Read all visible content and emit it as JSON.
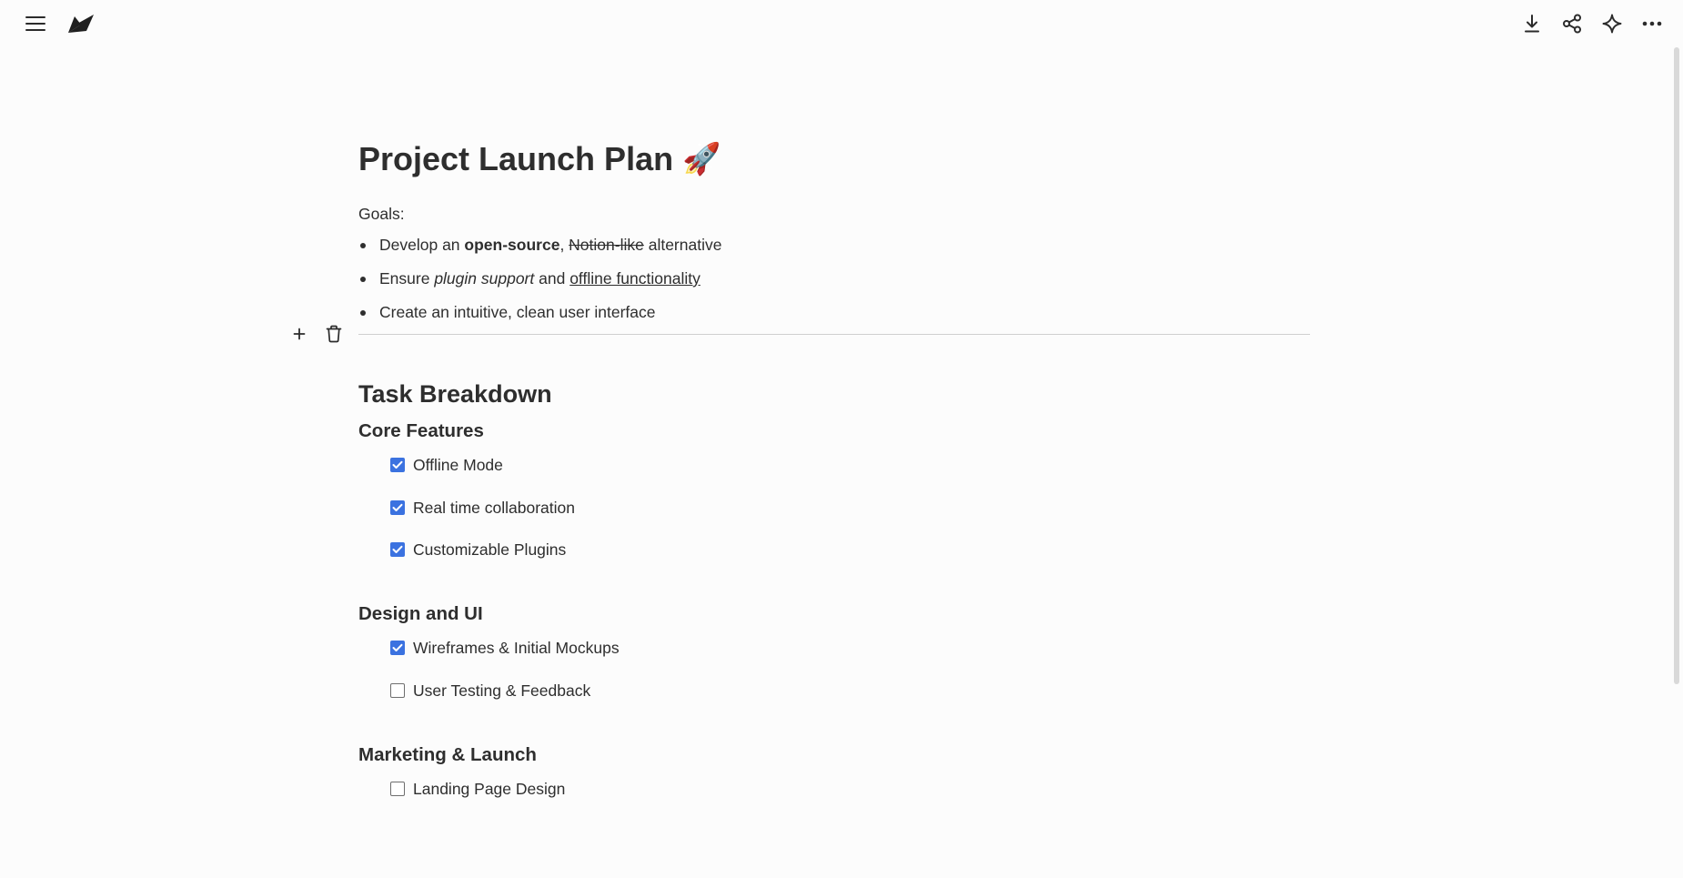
{
  "app": {
    "accent_color": "#3b72e0"
  },
  "toolbar": {
    "left": [
      {
        "icon": "menu-icon"
      },
      {
        "icon": "logo-icon"
      }
    ],
    "right": [
      {
        "icon": "download-icon"
      },
      {
        "icon": "share-icon"
      },
      {
        "icon": "sparkle-icon"
      },
      {
        "icon": "more-icon"
      }
    ]
  },
  "document": {
    "title": "Project Launch Plan",
    "title_emoji": "🚀",
    "goals_label": "Goals:",
    "goals": [
      {
        "prefix": "Develop an ",
        "bold": "open-source",
        "sep": ", ",
        "strike": "Notion-like",
        "suffix": " alternative"
      },
      {
        "prefix": "Ensure ",
        "italic": "plugin support",
        "mid": " and ",
        "underline": "offline functionality"
      },
      {
        "text": "Create an intuitive, clean user interface"
      }
    ],
    "block_tools": {
      "add_icon": "plus-icon",
      "delete_icon": "trash-icon"
    },
    "section_title": "Task Breakdown",
    "groups": [
      {
        "title": "Core Features",
        "tasks": [
          {
            "label": "Offline Mode",
            "checked": true
          },
          {
            "label": "Real time collaboration",
            "checked": true
          },
          {
            "label": "Customizable Plugins",
            "checked": true
          }
        ]
      },
      {
        "title": "Design and UI",
        "tasks": [
          {
            "label": "Wireframes & Initial Mockups",
            "checked": true
          },
          {
            "label": "User Testing & Feedback",
            "checked": false
          }
        ]
      },
      {
        "title": "Marketing & Launch",
        "tasks": [
          {
            "label": "Landing Page Design",
            "checked": false
          }
        ]
      }
    ]
  }
}
